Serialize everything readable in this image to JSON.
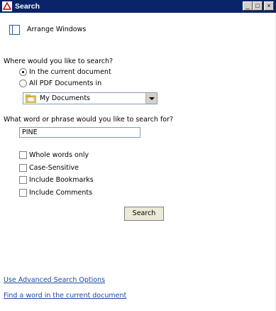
{
  "window": {
    "title": "Search",
    "controls": {
      "minimize": "_",
      "maximize": "□",
      "close": "×"
    }
  },
  "arrange": {
    "label": "Arrange Windows"
  },
  "where": {
    "question": "Where would you like to search?",
    "options": [
      {
        "label": "In the current document",
        "selected": true
      },
      {
        "label": "All PDF Documents in",
        "selected": false
      }
    ],
    "location_select": {
      "value": "My Documents",
      "icon": "folder-icon"
    }
  },
  "what": {
    "question": "What word or phrase would you like to search for?",
    "value": "PINE"
  },
  "options": [
    {
      "label": "Whole words only",
      "checked": false
    },
    {
      "label": "Case-Sensitive",
      "checked": false
    },
    {
      "label": "Include Bookmarks",
      "checked": false
    },
    {
      "label": "Include Comments",
      "checked": false
    }
  ],
  "search_button": "Search",
  "links": {
    "advanced": "Use Advanced Search Options",
    "find_word": "Find a word in the current document"
  }
}
